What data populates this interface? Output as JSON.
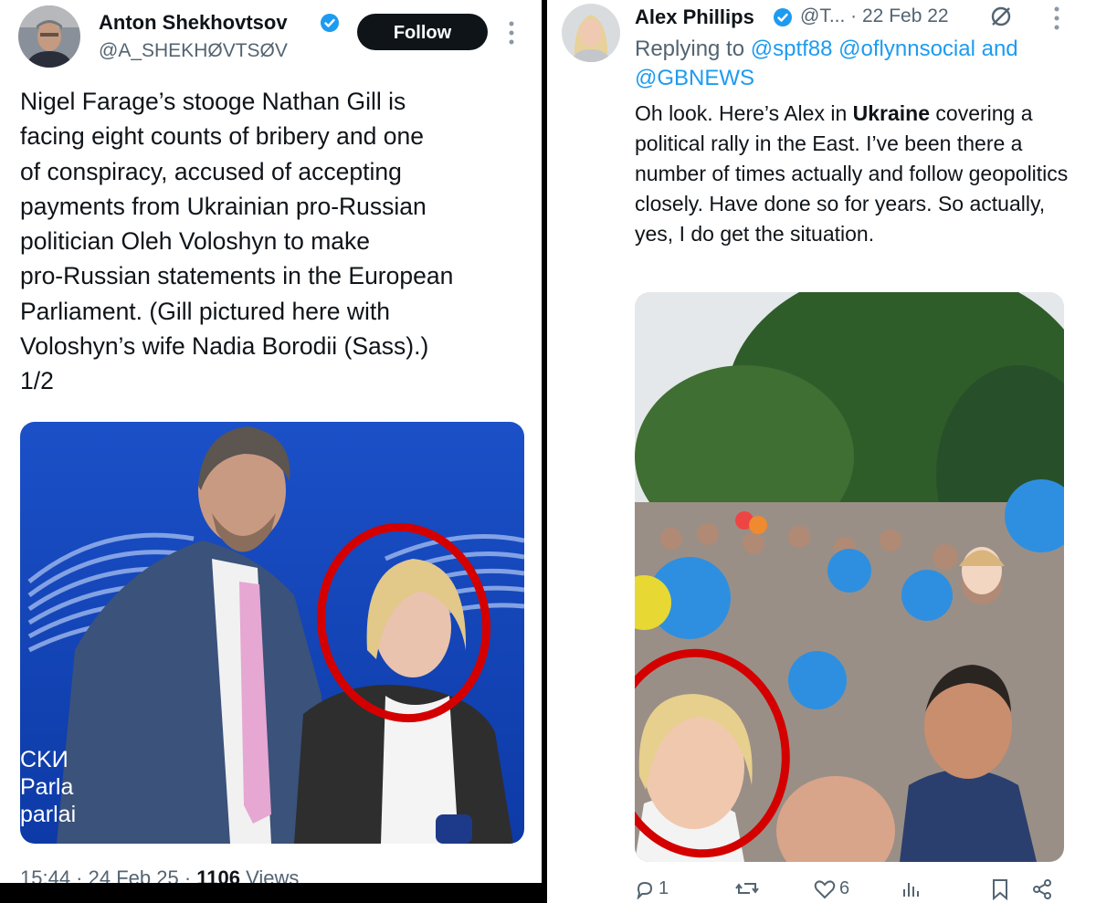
{
  "left_tweet": {
    "author_name": "Anton Shekhovtsov",
    "author_handle": "@A_SHEKHØVTSØV",
    "follow_label": "Follow",
    "text": "Nigel Farage’s stooge Nathan Gill is\nfacing eight counts of bribery and one\nof conspiracy, accused of accepting\npayments from Ukrainian pro-Russian\npolitician Oleh Voloshyn to make\npro-Russian statements in the European\nParliament. (Gill pictured here with\nVoloshyn’s wife Nadia Borodii (Sass).)\n1/2",
    "photo_sign_lines": [
      "CKИ",
      "Parla",
      "parlai"
    ],
    "time": "15:44",
    "date": "24 Feb 25",
    "views_count": "1106",
    "views_label": "Views"
  },
  "right_tweet": {
    "author_name": "Alex Phillips",
    "author_handle": "@T...",
    "date": "22 Feb 22",
    "replying_prefix": "Replying to",
    "reply_mentions": [
      "@sptf88",
      "@oflynnsocial",
      "@GBNEWS"
    ],
    "and_word": "and",
    "text_before": "Oh look. Here’s Alex in ",
    "text_bold": "Ukraine",
    "text_after": " covering a political rally in the East. I’ve been there a number of times actually and follow geopolitics closely. Have done so for years. So actually, yes, I do get the situation.",
    "reply_count": "1",
    "like_count": "6"
  },
  "colors": {
    "accent_blue": "#1d9bf0",
    "verified_blue": "#1d9bf0",
    "annotation_red": "#d40000",
    "text_primary": "#0f1419",
    "text_secondary": "#536471"
  },
  "icons": [
    "verified-badge-icon",
    "more-icon",
    "grok-icon",
    "reply-icon",
    "retweet-icon",
    "like-icon",
    "views-icon",
    "bookmark-icon",
    "share-icon"
  ]
}
